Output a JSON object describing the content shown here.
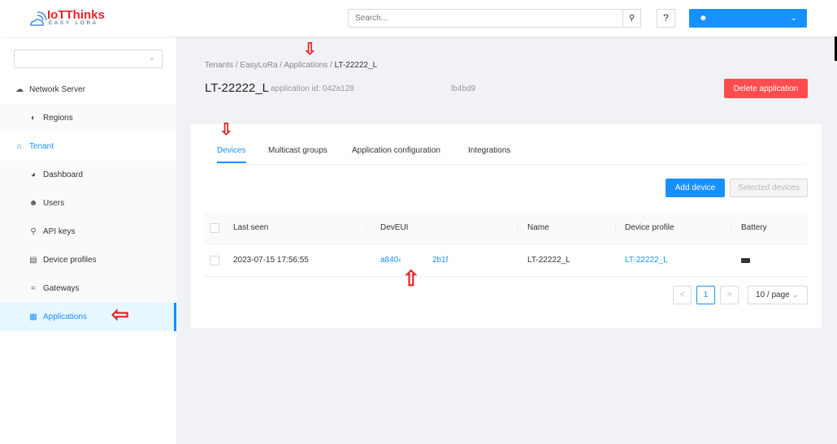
{
  "header": {
    "logo_title": "IoTThinks",
    "logo_subtitle": "EASY LORA",
    "search_placeholder": "Search...",
    "search_icon": "search-icon",
    "help_label": "?",
    "user_icon": "user-icon",
    "user_name": ""
  },
  "sidebar": {
    "tenant_select": "",
    "items": [
      {
        "label": "Network Server",
        "icon": "cloud-icon"
      },
      {
        "label": "Regions",
        "icon": "compass-icon"
      },
      {
        "label": "Tenant",
        "icon": "home-icon"
      },
      {
        "label": "Dashboard",
        "icon": "dashboard-icon"
      },
      {
        "label": "Users",
        "icon": "user-icon"
      },
      {
        "label": "API keys",
        "icon": "key-icon"
      },
      {
        "label": "Device profiles",
        "icon": "sliders-icon"
      },
      {
        "label": "Gateways",
        "icon": "wifi-icon"
      },
      {
        "label": "Applications",
        "icon": "appstore-icon"
      }
    ]
  },
  "breadcrumb": [
    "Tenants",
    "EasyLoRa",
    "Applications",
    "LT-22222_L"
  ],
  "page": {
    "title": "LT-22222_L",
    "app_id": "application id: 042a128",
    "app_id_tail": "lb4bd9",
    "delete_label": "Delete application"
  },
  "tabs": [
    "Devices",
    "Multicast groups",
    "Application configuration",
    "Integrations"
  ],
  "actions": {
    "add_device": "Add device",
    "selected_devices": "Selected devices"
  },
  "table": {
    "columns": [
      "Last seen",
      "DevEUI",
      "Name",
      "Device profile",
      "Battery"
    ],
    "rows": [
      {
        "last_seen": "2023-07-15 17:56:55",
        "deveui_a": "a840‹",
        "deveui_b": "2b1f",
        "name": "LT-22222_L",
        "profile": "LT-22222_L",
        "battery": "battery-icon"
      }
    ]
  },
  "pagination": {
    "prev": "<",
    "page": "1",
    "next": ">",
    "size": "10 / page"
  },
  "colors": {
    "primary": "#1890ff",
    "danger": "#ff4d4f",
    "annotation": "#e8262a"
  }
}
